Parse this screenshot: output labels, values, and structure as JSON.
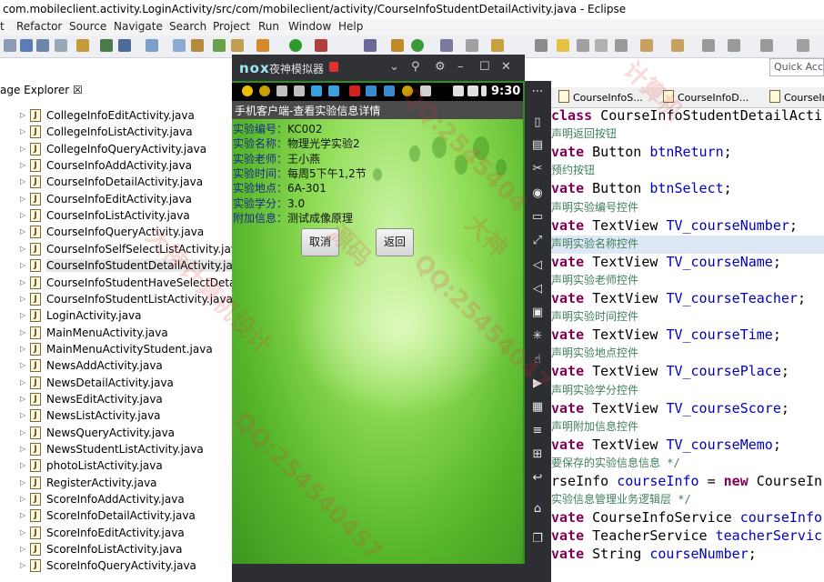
{
  "window": {
    "title": "com.mobileclient.activity.LoginActivity/src/com/mobileclient/activity/CourseInfoStudentDetailActivity.java - Eclipse"
  },
  "menu": [
    "t",
    "Refactor",
    "Source",
    "Navigate",
    "Search",
    "Project",
    "Run",
    "Window",
    "Help"
  ],
  "quick_access": "Quick Access",
  "package_explorer": {
    "tab_label": "age Explorer ☒",
    "files": [
      "CollegeInfoEditActivity.java",
      "CollegeInfoListActivity.java",
      "CollegeInfoQueryActivity.java",
      "CourseInfoAddActivity.java",
      "CourseInfoDetailActivity.java",
      "CourseInfoEditActivity.java",
      "CourseInfoListActivity.java",
      "CourseInfoQueryActivity.java",
      "CourseInfoSelfSelectListActivity.java",
      "CourseInfoStudentDetailActivity.java",
      "CourseInfoStudentHaveSelectDetailActi",
      "CourseInfoStudentListActivity.java",
      "LoginActivity.java",
      "MainMenuActivity.java",
      "MainMenuActivityStudent.java",
      "NewsAddActivity.java",
      "NewsDetailActivity.java",
      "NewsEditActivity.java",
      "NewsListActivity.java",
      "NewsQueryActivity.java",
      "NewsStudentListActivity.java",
      "photoListActivity.java",
      "RegisterActivity.java",
      "ScoreInfoAddActivity.java",
      "ScoreInfoDetailActivity.java",
      "ScoreInfoEditActivity.java",
      "ScoreInfoListActivity.java",
      "ScoreInfoQueryActivity.java"
    ]
  },
  "editor": {
    "tabs": [
      "CourseInfoS...",
      "CourseInfoD...",
      "CourseInfo"
    ],
    "lines": [
      {
        "type": "code",
        "html": "<span class=\"kw\">class</span> CourseInfoStudentDetailActi"
      },
      {
        "type": "comment",
        "html": "声明返回按钮"
      },
      {
        "type": "code",
        "html": "<span class=\"kw\">vate</span> Button <span class=\"fld\">btnReturn</span>;"
      },
      {
        "type": "comment",
        "html": "预约按钮"
      },
      {
        "type": "code",
        "html": "<span class=\"kw\">vate</span> Button <span class=\"fld\">btnSelect</span>;"
      },
      {
        "type": "comment",
        "html": "声明实验编号控件"
      },
      {
        "type": "code",
        "html": "<span class=\"kw\">vate</span> TextView <span class=\"fld\">TV_courseNumber</span>;"
      },
      {
        "type": "comment",
        "hl": true,
        "html": "声明实验名称控件"
      },
      {
        "type": "code",
        "html": "<span class=\"kw\">vate</span> TextView <span class=\"fld\">TV_courseName</span>;"
      },
      {
        "type": "comment",
        "html": "声明实验老师控件"
      },
      {
        "type": "code",
        "html": "<span class=\"kw\">vate</span> TextView <span class=\"fld\">TV_courseTeacher</span>;"
      },
      {
        "type": "comment",
        "html": "声明实验时间控件"
      },
      {
        "type": "code",
        "html": "<span class=\"kw\">vate</span> TextView <span class=\"fld\">TV_courseTime</span>;"
      },
      {
        "type": "comment",
        "html": "声明实验地点控件"
      },
      {
        "type": "code",
        "html": "<span class=\"kw\">vate</span> TextView <span class=\"fld\">TV_coursePlace</span>;"
      },
      {
        "type": "comment",
        "html": "声明实验学分控件"
      },
      {
        "type": "code",
        "html": "<span class=\"kw\">vate</span> TextView <span class=\"fld\">TV_courseScore</span>;"
      },
      {
        "type": "comment",
        "html": "声明附加信息控件"
      },
      {
        "type": "code",
        "html": "<span class=\"kw\">vate</span> TextView <span class=\"fld\">TV_courseMemo</span>;"
      },
      {
        "type": "comment",
        "html": "要保存的实验信息信息 */"
      },
      {
        "type": "code",
        "html": "rseInfo <span class=\"fld\">courseInfo</span> = <span class=\"kw\">new</span> CourseIn"
      },
      {
        "type": "comment",
        "html": "实验信息管理业务逻辑层 */"
      },
      {
        "type": "code",
        "html": "<span class=\"kw\">vate</span> CourseInfoService <span class=\"fld\">courseInfo</span>"
      },
      {
        "type": "code",
        "html": "<span class=\"kw\">vate</span> TeacherService <span class=\"fld\">teacherServic</span>"
      },
      {
        "type": "code",
        "html": "<span class=\"kw\">vate</span> String <span class=\"fld\">courseNumber</span>;"
      }
    ]
  },
  "emulator": {
    "logo": "nox",
    "title": "夜神模拟器",
    "clock": "9:30",
    "app_title": "手机客户端-查看实验信息详情",
    "info": [
      {
        "label": "实验编号：",
        "value": "KC002"
      },
      {
        "label": "实验名称：",
        "value": "物理光学实验2"
      },
      {
        "label": "实验老师：",
        "value": "王小燕"
      },
      {
        "label": "实验时间：",
        "value": "每周5下午1,2节"
      },
      {
        "label": "实验地点：",
        "value": "6A-301"
      },
      {
        "label": "实验学分：",
        "value": "3.0"
      },
      {
        "label": "附加信息：",
        "value": "测试成像原理"
      }
    ],
    "cancel_label": "取消",
    "back_label": "返回"
  },
  "watermarks": [
    "QQ:2545404",
    "大神计算机设计",
    "源码",
    "QQ:25454047",
    "大神",
    "计算机",
    "QQ:254540457"
  ]
}
